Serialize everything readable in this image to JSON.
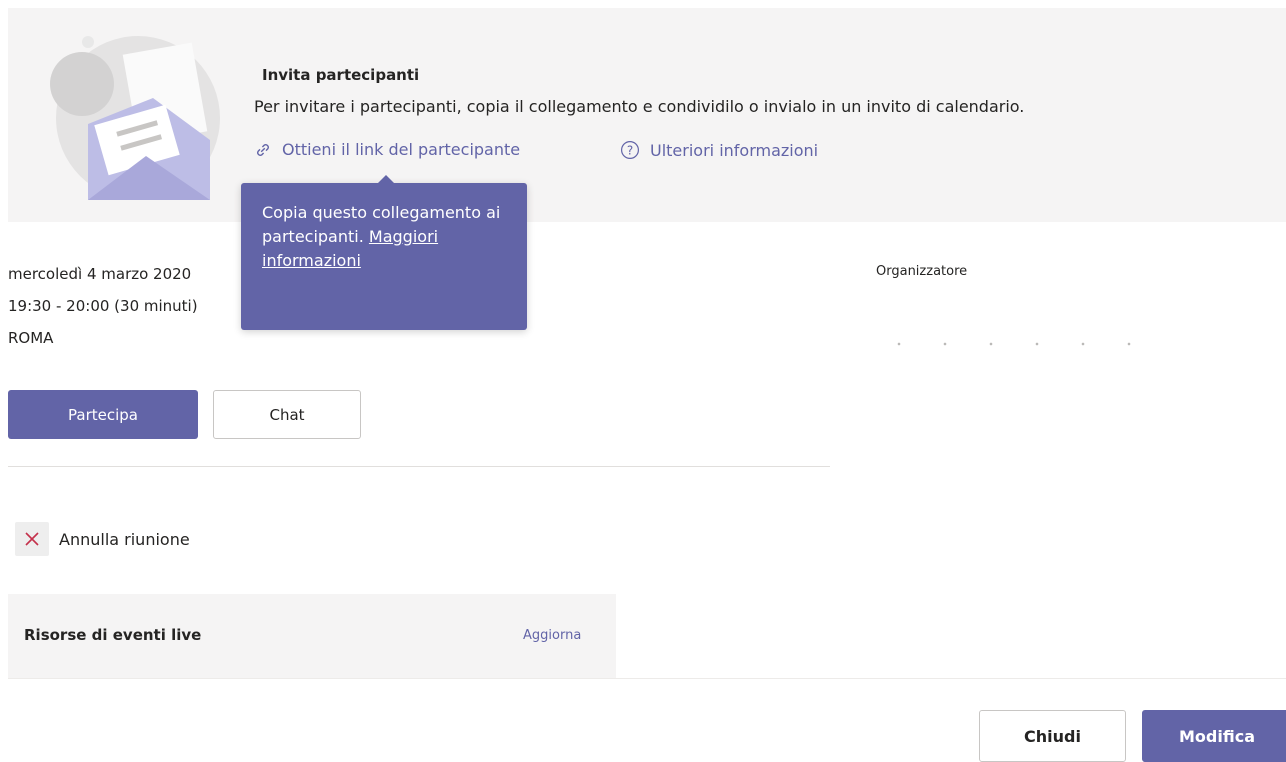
{
  "invite": {
    "title": "Invita partecipanti",
    "description": "Per invitare i partecipanti, copia il collegamento e condividilo o invialo in un invito di calendario.",
    "participant_link": "Ottieni il link del partecipante",
    "more_info_link": "Ulteriori informazioni"
  },
  "tooltip": {
    "text": "Copia questo collegamento ai partecipanti.",
    "link": "Maggiori informazioni"
  },
  "meeting": {
    "date": "mercoledì 4 marzo 2020",
    "time": "19:30 - 20:00 (30 minuti)",
    "location": "ROMA"
  },
  "organizer": {
    "label": "Organizzatore"
  },
  "actions": {
    "join": "Partecipa",
    "chat": "Chat",
    "cancel_meeting": "Annulla riunione"
  },
  "live_event": {
    "title": "Risorse di eventi live",
    "update": "Aggiorna"
  },
  "footer": {
    "close": "Chiudi",
    "edit": "Modifica"
  },
  "colors": {
    "accent": "#6264a7",
    "banner_bg": "#f5f4f4",
    "cancel_icon": "#c4314b"
  },
  "icons": {
    "illustration": "envelope-invite-illustration",
    "participant_link": "link-icon",
    "more_info": "help-circle-icon",
    "cancel": "close-x-icon"
  }
}
